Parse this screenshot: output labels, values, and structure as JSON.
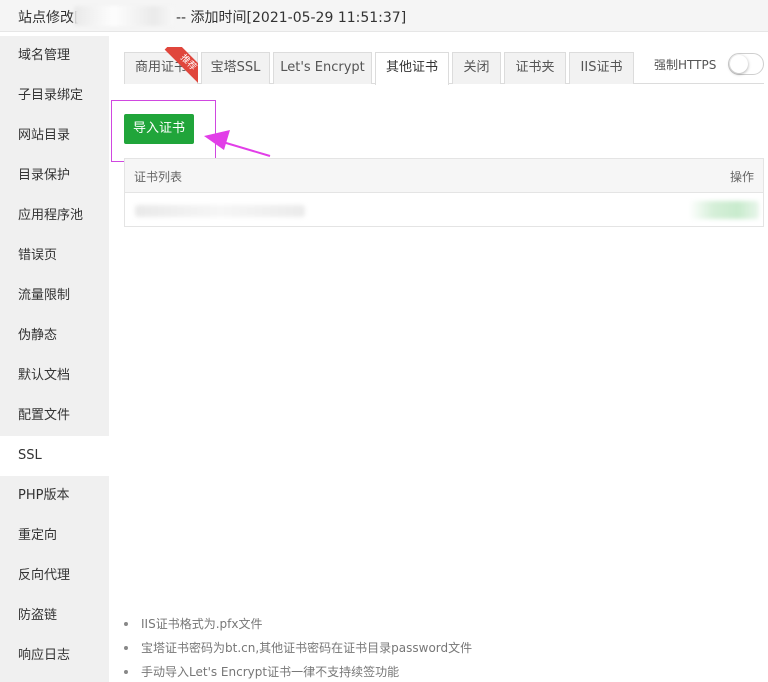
{
  "header": {
    "title_prefix": "站点修改[",
    "title_suffix": "-- 添加时间[2021-05-29 11:51:37]"
  },
  "sidebar": {
    "items": [
      {
        "label": "域名管理"
      },
      {
        "label": "子目录绑定"
      },
      {
        "label": "网站目录"
      },
      {
        "label": "目录保护"
      },
      {
        "label": "应用程序池"
      },
      {
        "label": "错误页"
      },
      {
        "label": "流量限制"
      },
      {
        "label": "伪静态"
      },
      {
        "label": "默认文档"
      },
      {
        "label": "配置文件"
      },
      {
        "label": "SSL"
      },
      {
        "label": "PHP版本"
      },
      {
        "label": "重定向"
      },
      {
        "label": "反向代理"
      },
      {
        "label": "防盗链"
      },
      {
        "label": "响应日志"
      }
    ],
    "active_item": "SSL"
  },
  "tabs": {
    "items": [
      {
        "label": "商用证书"
      },
      {
        "label": "宝塔SSL"
      },
      {
        "label": "Let's Encrypt"
      },
      {
        "label": "其他证书"
      },
      {
        "label": "关闭"
      },
      {
        "label": "证书夹"
      },
      {
        "label": "IIS证书"
      }
    ],
    "active_tab": "其他证书",
    "recommend_badge": "推荐"
  },
  "https": {
    "label": "强制HTTPS",
    "enabled": false
  },
  "toolbar": {
    "import_label": "导入证书"
  },
  "cert_table": {
    "headers": {
      "name": "证书列表",
      "action": "操作"
    }
  },
  "tips": [
    "IIS证书格式为.pfx文件",
    "宝塔证书密码为bt.cn,其他证书密码在证书目录password文件",
    "手动导入Let's Encrypt证书一律不支持续签功能"
  ],
  "colors": {
    "primary_green": "#20a53a",
    "annotation_magenta": "#e23ee8",
    "badge_red": "#e0463c"
  }
}
